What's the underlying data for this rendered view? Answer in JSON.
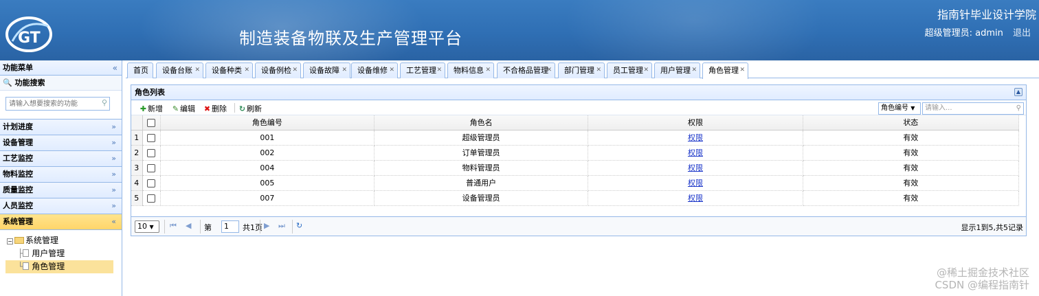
{
  "header": {
    "app_title": "制造装备物联及生产管理平台",
    "school": "指南针毕业设计学院",
    "user_label": "超级管理员: admin",
    "logout": "退出",
    "logo_text": "GT",
    "colors": {
      "header_bg": "#2f6fb4",
      "accent": "#95b8e7"
    }
  },
  "sidebar": {
    "title": "功能菜单",
    "search_title": "功能搜索",
    "search_placeholder": "请输入想要搜索的功能",
    "sections": [
      {
        "label": "计划进度"
      },
      {
        "label": "设备管理"
      },
      {
        "label": "工艺监控"
      },
      {
        "label": "物料监控"
      },
      {
        "label": "质量监控"
      },
      {
        "label": "人员监控"
      },
      {
        "label": "系统管理"
      }
    ],
    "tree": {
      "root": "系统管理",
      "children": [
        "用户管理",
        "角色管理"
      ]
    }
  },
  "tabs": [
    {
      "label": "首页"
    },
    {
      "label": "设备台账"
    },
    {
      "label": "设备种类"
    },
    {
      "label": "设备例检"
    },
    {
      "label": "设备故障"
    },
    {
      "label": "设备维修"
    },
    {
      "label": "工艺管理"
    },
    {
      "label": "物料信息"
    },
    {
      "label": "不合格品管理"
    },
    {
      "label": "部门管理"
    },
    {
      "label": "员工管理"
    },
    {
      "label": "用户管理"
    },
    {
      "label": "角色管理"
    }
  ],
  "panel": {
    "title": "角色列表",
    "toolbar": {
      "add": "新增",
      "edit": "编辑",
      "delete": "删除",
      "refresh": "刷新"
    },
    "filter": {
      "field": "角色编号",
      "placeholder": "请输入..."
    },
    "columns": [
      "角色编号",
      "角色名",
      "权限",
      "状态"
    ],
    "rows": [
      {
        "n": "1",
        "code": "001",
        "name": "超级管理员",
        "perm": "权限",
        "status": "有效"
      },
      {
        "n": "2",
        "code": "002",
        "name": "订单管理员",
        "perm": "权限",
        "status": "有效"
      },
      {
        "n": "3",
        "code": "004",
        "name": "物料管理员",
        "perm": "权限",
        "status": "有效"
      },
      {
        "n": "4",
        "code": "005",
        "name": "普通用户",
        "perm": "权限",
        "status": "有效"
      },
      {
        "n": "5",
        "code": "007",
        "name": "设备管理员",
        "perm": "权限",
        "status": "有效"
      }
    ],
    "pager": {
      "page_size": "10",
      "page_prefix": "第",
      "page_value": "1",
      "page_total": "共1页",
      "info": "显示1到5,共5记录"
    }
  },
  "watermark": {
    "line1": "@稀土掘金技术社区",
    "line2": "CSDN @编程指南针"
  }
}
